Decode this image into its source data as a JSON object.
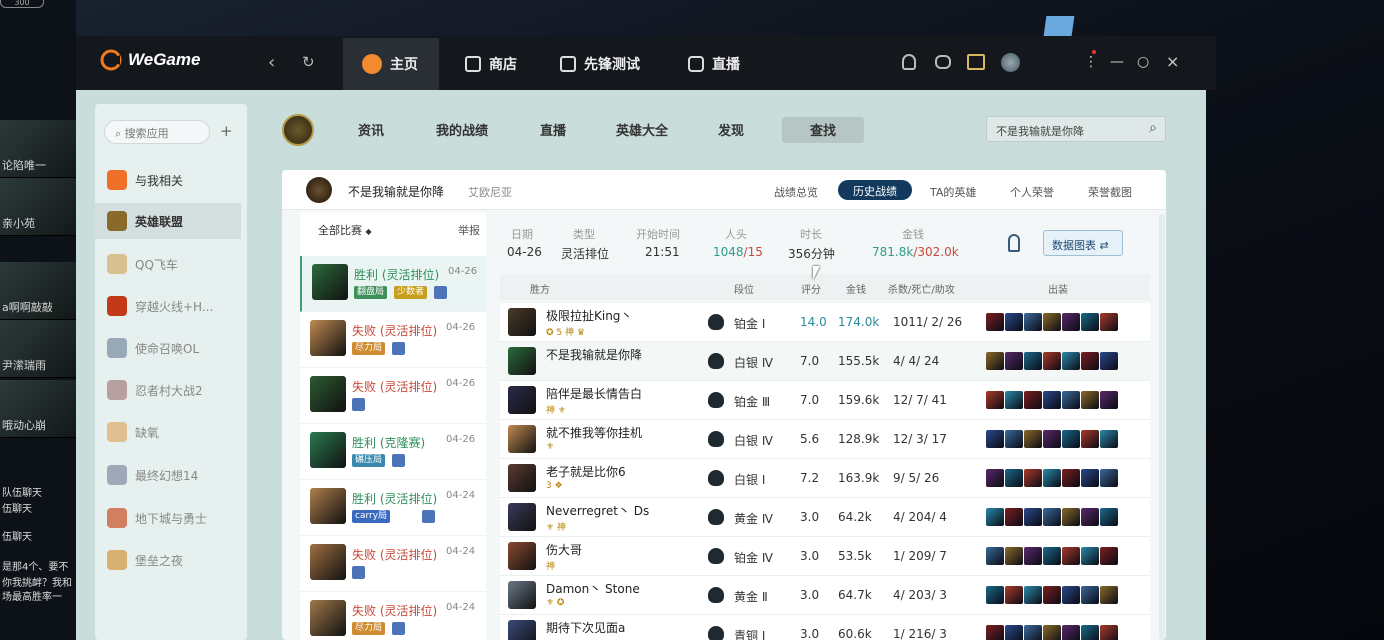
{
  "desktop": {
    "top_badge": "300",
    "thumbs": [
      "论陷唯一",
      "亲小苑",
      "a啊啊敲敲",
      "尹潆瑞雨",
      "哦动心崩"
    ],
    "chat_lines": [
      "队伍聊天",
      "伍聊天",
      "伍聊天",
      "是那4个、要不",
      "你我挑衅？我和",
      "场最高胜率一"
    ]
  },
  "titlebar": {
    "brand": "WeGame",
    "tabs": [
      {
        "label": "主页",
        "icon": "home-icon"
      },
      {
        "label": "商店",
        "icon": "bag-icon"
      },
      {
        "label": "先锋测试",
        "icon": "test-icon"
      },
      {
        "label": "直播",
        "icon": "play-icon"
      }
    ],
    "controls": {
      "menu": "⋮",
      "minimize": "—",
      "maximize": "○",
      "close": "×"
    }
  },
  "sidebar": {
    "search_placeholder": "搜索应用",
    "add": "+",
    "items": [
      {
        "label": "与我相关",
        "color": "#f0702a"
      },
      {
        "label": "英雄联盟",
        "color": "#8a6a2a"
      },
      {
        "label": "QQ飞车",
        "color": "#d9c090"
      },
      {
        "label": "穿越火线+H...",
        "color": "#c23a1a"
      },
      {
        "label": "使命召唤OL",
        "color": "#9aa9b8"
      },
      {
        "label": "忍者村大战2",
        "color": "#b8a0a0"
      },
      {
        "label": "缺氧",
        "color": "#e0c090"
      },
      {
        "label": "最终幻想14",
        "color": "#a0a8b8"
      },
      {
        "label": "地下城与勇士",
        "color": "#d08060"
      },
      {
        "label": "堡垒之夜",
        "color": "#d8b070"
      }
    ]
  },
  "game_nav": {
    "items": [
      "资讯",
      "我的战绩",
      "直播",
      "英雄大全",
      "发现",
      "查找"
    ],
    "search_value": "不是我输就是你降"
  },
  "player": {
    "name": "不是我输就是你降",
    "server": "艾欧尼亚",
    "tabs": [
      "战绩总览",
      "历史战绩",
      "TA的英雄",
      "个人荣誉",
      "荣誉截图"
    ]
  },
  "match_list": {
    "filter": "全部比赛",
    "report": "举报",
    "items": [
      {
        "result": "胜利 (灵活排位)",
        "date": "04-26",
        "win": true,
        "tags": [
          {
            "t": "翻盘局",
            "c": "#3d8f5c"
          },
          {
            "t": "少数者",
            "c": "#c8a020"
          }
        ],
        "color": "#2c6b3c"
      },
      {
        "result": "失败 (灵活排位)",
        "date": "04-26",
        "win": false,
        "tags": [
          {
            "t": "尽力局",
            "c": "#d08a30"
          }
        ],
        "color": "#c08a50"
      },
      {
        "result": "失败 (灵活排位)",
        "date": "04-26",
        "win": false,
        "tags": [],
        "color": "#2c5a30"
      },
      {
        "result": "胜利 (克隆赛)",
        "date": "04-26",
        "win": true,
        "tags": [
          {
            "t": "碾压局",
            "c": "#3a8ab0"
          }
        ],
        "color": "#2a7a50"
      },
      {
        "result": "胜利 (灵活排位)",
        "date": "04-24",
        "win": true,
        "tags": [
          {
            "t": "carry局",
            "c": "#3a6ac0"
          }
        ],
        "color": "#b0804a"
      },
      {
        "result": "失败 (灵活排位)",
        "date": "04-24",
        "win": false,
        "tags": [],
        "color": "#a07040"
      },
      {
        "result": "失败 (灵活排位)",
        "date": "04-24",
        "win": false,
        "tags": [
          {
            "t": "尽力局",
            "c": "#d08a30"
          }
        ],
        "color": "#a07848"
      }
    ]
  },
  "summary": {
    "labels": [
      "日期",
      "类型",
      "开始时间",
      "人头",
      "时长",
      "金钱"
    ],
    "date": "04-26",
    "type": "灵活排位",
    "start": "21:51",
    "kills_a": "1048",
    "kills_b": "/15",
    "duration": "356分钟",
    "gold_a": "781.8k",
    "gold_b": "/302.0k",
    "data_btn": "数据图表 ⇄"
  },
  "table": {
    "headers": [
      "胜方",
      "段位",
      "评分",
      "金钱",
      "杀数/死亡/助攻",
      "出装"
    ],
    "rows": [
      {
        "name": "极限拉扯King丶",
        "badges": "✪ 5 神 ♛",
        "rank": "铂金 Ⅰ",
        "score": "14.0",
        "gold": "174.0k",
        "kda": "1011/ 2/ 26",
        "hl": true,
        "color": "#4a3a2a"
      },
      {
        "name": "不是我输就是你降",
        "badges": "",
        "rank": "白银 Ⅳ",
        "score": "7.0",
        "gold": "155.5k",
        "kda": "4/ 4/ 24",
        "hl": false,
        "color": "#2c6b3c"
      },
      {
        "name": "陪伴是最长情告白",
        "badges": "神 ⚜",
        "rank": "铂金 Ⅲ",
        "score": "7.0",
        "gold": "159.6k",
        "kda": "12/ 7/ 41",
        "hl": false,
        "color": "#2a2a48"
      },
      {
        "name": "就不推我等你挂机",
        "badges": "⚜",
        "rank": "白银 Ⅳ",
        "score": "5.6",
        "gold": "128.9k",
        "kda": "12/ 3/ 17",
        "hl": false,
        "color": "#c08a50"
      },
      {
        "name": "老子就是比你6",
        "badges": "3 ❖",
        "rank": "白银 Ⅰ",
        "score": "7.2",
        "gold": "163.9k",
        "kda": "9/ 5/ 26",
        "hl": false,
        "color": "#5a3a30"
      },
      {
        "name": "Neverregret丶 Ds",
        "badges": "⚜ 神",
        "rank": "黄金 Ⅳ",
        "score": "3.0",
        "gold": "64.2k",
        "kda": "4/ 204/ 4",
        "hl": false,
        "color": "#3a3a5a"
      },
      {
        "name": "伤大哥",
        "badges": "神",
        "rank": "铂金 Ⅳ",
        "score": "3.0",
        "gold": "53.5k",
        "kda": "1/ 209/ 7",
        "hl": false,
        "color": "#8a4a30"
      },
      {
        "name": "Damon丶 Stone",
        "badges": "⚜ ✪",
        "rank": "黄金 Ⅱ",
        "score": "3.0",
        "gold": "64.7k",
        "kda": "4/ 203/ 3",
        "hl": false,
        "color": "#6a7a8a"
      },
      {
        "name": "期待下次见面a",
        "badges": "",
        "rank": "青铜 Ⅰ",
        "score": "3.0",
        "gold": "60.6k",
        "kda": "1/ 216/ 3",
        "hl": false,
        "color": "#3a4a7a"
      }
    ]
  },
  "colors": {
    "accent": "#133a5e",
    "win": "#2f8f5e",
    "lose": "#c8493a",
    "highlight": "#2a8a9a"
  }
}
